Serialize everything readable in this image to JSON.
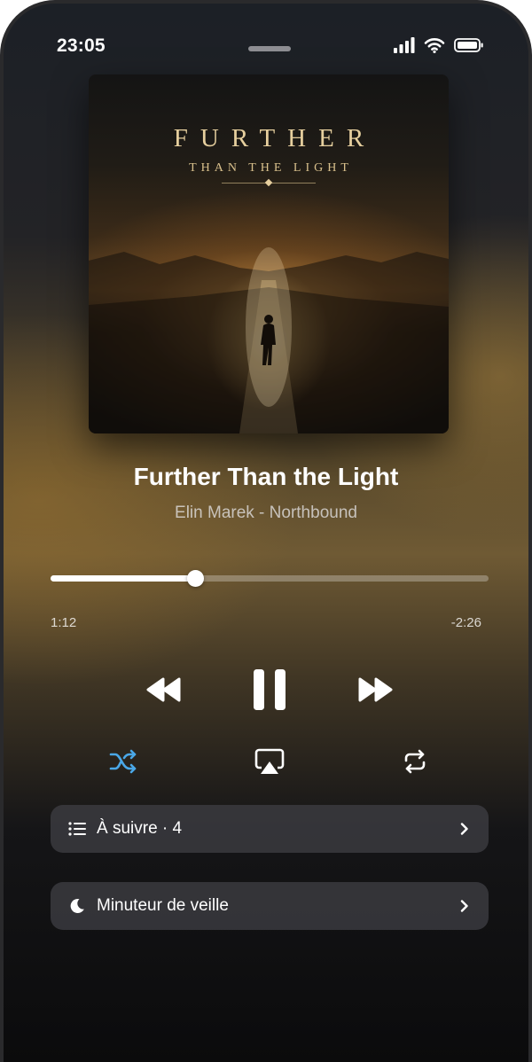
{
  "status_bar": {
    "time": "23:05"
  },
  "artwork": {
    "title_text": "FURTHER",
    "subtitle_text": "THAN THE LIGHT"
  },
  "track": {
    "title": "Further Than the Light",
    "subtitle": "Elin Marek - Northbound"
  },
  "playback": {
    "elapsed": "1:12",
    "remaining": "-2:26",
    "progress": 0.33,
    "state": "playing"
  },
  "controls": {
    "rewind_icon": "rewind-icon",
    "pause_icon": "pause-icon",
    "forward_icon": "fast-forward-icon",
    "shuffle_icon": "shuffle-icon",
    "shuffle_active": true,
    "airplay_icon": "airplay-icon",
    "repeat_icon": "repeat-icon"
  },
  "rows": [
    {
      "label": "À suivre · 4",
      "icon": "list-icon"
    },
    {
      "label": "Minuteur de veille",
      "icon": "moon-icon"
    }
  ],
  "colors": {
    "accent": "#4aa8e8",
    "text": "#ffffff",
    "row_background": "#3e3e42"
  }
}
